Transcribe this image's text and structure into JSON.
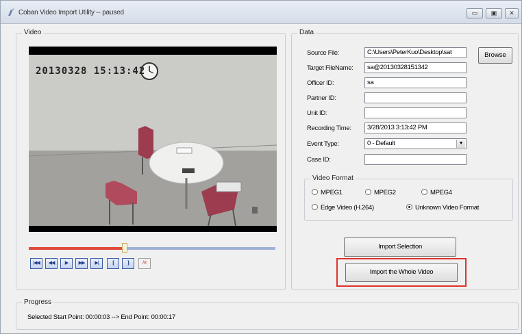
{
  "window": {
    "title": "Coban Video Import Utility -- paused",
    "controls": {
      "minimize": "▭",
      "maximize": "▣",
      "close": "✕"
    }
  },
  "video_panel": {
    "legend": "Video",
    "overlay_timestamp": "20130328  15:13:42",
    "timeline_progress": 0.39,
    "controls": [
      {
        "icon": "skip-to-start-icon",
        "glyph": "|◀◀"
      },
      {
        "icon": "rewind-icon",
        "glyph": "◀◀"
      },
      {
        "icon": "play-icon",
        "glyph": "▶"
      },
      {
        "icon": "fast-forward-icon",
        "glyph": "▶▶"
      },
      {
        "icon": "skip-to-end-icon",
        "glyph": "▶|"
      },
      {
        "icon": "mark-start-icon",
        "glyph": "|["
      },
      {
        "icon": "mark-end-icon",
        "glyph": "]|"
      },
      {
        "icon": "clear-marks-icon",
        "glyph": "/✕"
      }
    ]
  },
  "data_panel": {
    "legend": "Data",
    "source_file": {
      "label": "Source File:",
      "value": "C:\\Users\\PeterKuo\\Desktop\\sat"
    },
    "browse_label": "Browse",
    "target_filename": {
      "label": "Target FileName:",
      "value": "sa@20130328151342"
    },
    "officer_id": {
      "label": "Officer ID:",
      "value": "sa"
    },
    "partner_id": {
      "label": "Partner ID:",
      "value": ""
    },
    "unit_id": {
      "label": "Unit ID:",
      "value": ""
    },
    "recording_time": {
      "label": "Recording Time:",
      "value": "3/28/2013 3:13:42 PM"
    },
    "event_type": {
      "label": "Event Type:",
      "value": "0 - Default"
    },
    "case_id": {
      "label": "Case ID:",
      "value": ""
    },
    "video_format": {
      "legend": "Video Format",
      "options": [
        {
          "label": "MPEG1",
          "selected": false
        },
        {
          "label": "MPEG2",
          "selected": false
        },
        {
          "label": "MPEG4",
          "selected": false
        },
        {
          "label": "Edge Video (H.264)",
          "selected": false
        },
        {
          "label": "Unknown Video Format",
          "selected": true
        }
      ]
    },
    "import_selection_label": "Import Selection",
    "import_whole_label": "Import the Whole Video",
    "highlight_color": "#e0312a"
  },
  "progress": {
    "legend": "Progress",
    "text": "Selected Start Point: 00:00:03 --> End Point: 00:00:17"
  }
}
